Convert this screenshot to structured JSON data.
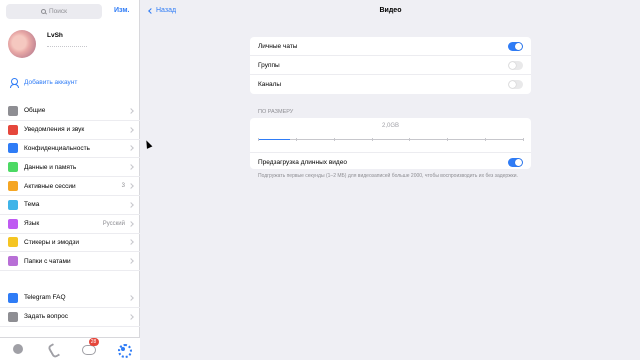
{
  "sidebar": {
    "search_placeholder": "Поиск",
    "edit_label": "Изм.",
    "profile": {
      "name": "LvSh"
    },
    "add_account": "Добавить аккаунт",
    "items": [
      {
        "label": "Общие",
        "icon": "gear-icon",
        "color": "#8e8e93",
        "value": ""
      },
      {
        "label": "Уведомления и звук",
        "icon": "bell-icon",
        "color": "#e5473c",
        "value": ""
      },
      {
        "label": "Конфиденциальность",
        "icon": "lock-icon",
        "color": "#2f7cf6",
        "value": ""
      },
      {
        "label": "Данные и память",
        "icon": "database-icon",
        "color": "#4cd964",
        "value": ""
      },
      {
        "label": "Активные сессии",
        "icon": "devices-icon",
        "color": "#f5a623",
        "value": "3"
      },
      {
        "label": "Тема",
        "icon": "brush-icon",
        "color": "#3fb4e8",
        "value": ""
      },
      {
        "label": "Язык",
        "icon": "globe-icon",
        "color": "#bf5af2",
        "value": "Русский"
      },
      {
        "label": "Стикеры и эмодзи",
        "icon": "sticker-icon",
        "color": "#f5c523",
        "value": ""
      },
      {
        "label": "Папки с чатами",
        "icon": "folder-icon",
        "color": "#b86fd6",
        "value": ""
      }
    ],
    "items2": [
      {
        "label": "Telegram FAQ",
        "icon": "question-icon",
        "color": "#2f7cf6"
      },
      {
        "label": "Задать вопрос",
        "icon": "chat-bubble-icon",
        "color": "#8e8e93"
      }
    ],
    "tabbar": {
      "chats_badge": "28"
    }
  },
  "main": {
    "back_label": "Назад",
    "title": "Видео",
    "toggles": [
      {
        "label": "Личные чаты",
        "on": true
      },
      {
        "label": "Группы",
        "on": false
      },
      {
        "label": "Каналы",
        "on": false
      }
    ],
    "size_section_header": "ПО РАЗМЕРУ",
    "size_value": "2,0GB",
    "slider_level": 0.12,
    "preload_label": "Предзагрузка длинных видео",
    "preload_on": true,
    "footnote": "Подгружать первые секунды (1–2 МБ) для видеозаписей больше 2000, чтобы воспроизводить их без задержки."
  }
}
